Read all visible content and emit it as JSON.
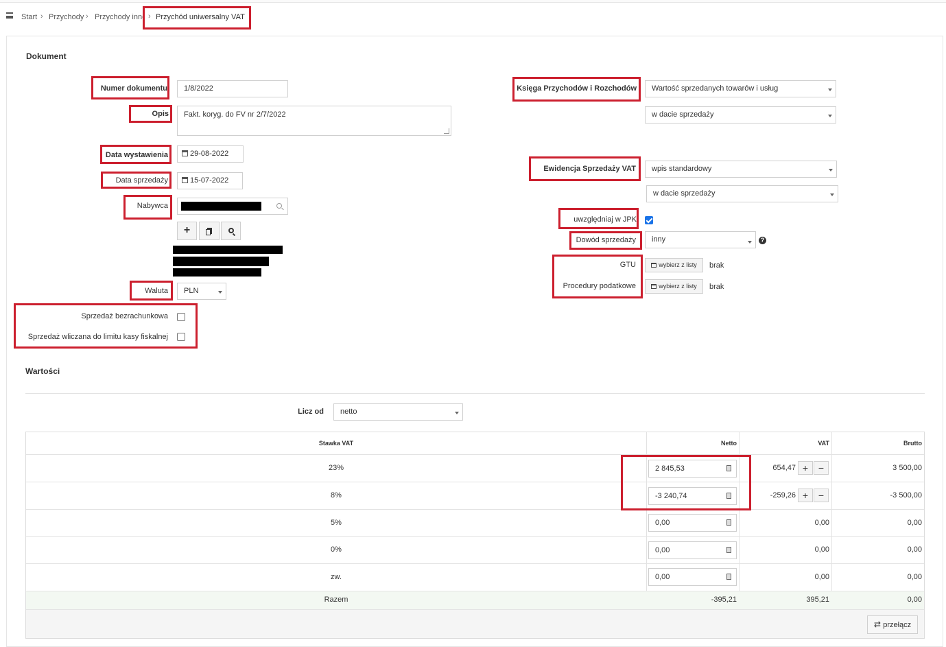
{
  "breadcrumb": {
    "menu_icon": "menu-icon",
    "items": [
      "Start",
      "Przychody",
      "Przychody inne",
      "Przychód uniwersalny VAT"
    ],
    "sep": "›"
  },
  "dokument": {
    "title": "Dokument",
    "numer_label": "Numer dokumentu",
    "numer_value": "1/8/2022",
    "opis_label": "Opis",
    "opis_value": "Fakt. koryg. do FV nr 2/7/2022",
    "data_wyst_label": "Data wystawienia",
    "data_wyst_value": "29-08-2022",
    "data_sprz_label": "Data sprzedaży",
    "data_sprz_value": "15-07-2022",
    "nabywca_label": "Nabywca",
    "waluta_label": "Waluta",
    "waluta_value": "PLN",
    "bezrachunkowa_label": "Sprzedaż bezrachunkowa",
    "limit_kasy_label": "Sprzedaż wliczana do limitu kasy fiskalnej",
    "ksiega_label": "Księga Przychodów i Rozchodów",
    "ksiega_value": "Wartość sprzedanych towarów i usług",
    "ksiega_data_value": "w dacie sprzedaży",
    "ewidencja_label": "Ewidencja Sprzedaży VAT",
    "ewidencja_value": "wpis standardowy",
    "ewidencja_data_value": "w dacie sprzedaży",
    "jpk_label": "uwzględniaj w JPK",
    "dowod_label": "Dowód sprzedaży",
    "dowod_value": "inny",
    "gtu_label": "GTU",
    "procedury_label": "Procedury podatkowe",
    "wybierz_label": "wybierz z listy",
    "brak": "brak"
  },
  "wartosci": {
    "title": "Wartości",
    "licz_od_label": "Licz od",
    "licz_od_value": "netto",
    "headers": {
      "stawka": "Stawka VAT",
      "netto": "Netto",
      "vat": "VAT",
      "brutto": "Brutto"
    },
    "rows": [
      {
        "stawka": "23%",
        "netto": "2 845,53",
        "vat": "654,47",
        "brutto": "3 500,00"
      },
      {
        "stawka": "8%",
        "netto": "-3 240,74",
        "vat": "-259,26",
        "brutto": "-3 500,00"
      },
      {
        "stawka": "5%",
        "netto": "0,00",
        "vat": "0,00",
        "brutto": "0,00"
      },
      {
        "stawka": "0%",
        "netto": "0,00",
        "vat": "0,00",
        "brutto": "0,00"
      },
      {
        "stawka": "zw.",
        "netto": "0,00",
        "vat": "0,00",
        "brutto": "0,00"
      }
    ],
    "razem": {
      "label": "Razem",
      "netto": "-395,21",
      "vat": "395,21",
      "brutto": "0,00"
    },
    "plus": "+",
    "minus": "−",
    "przelacz_label": "przełącz"
  },
  "colors": {
    "highlight": "#cc1f2e",
    "checkbox": "#1a73e8",
    "razem_bg": "#f3f8f2"
  }
}
